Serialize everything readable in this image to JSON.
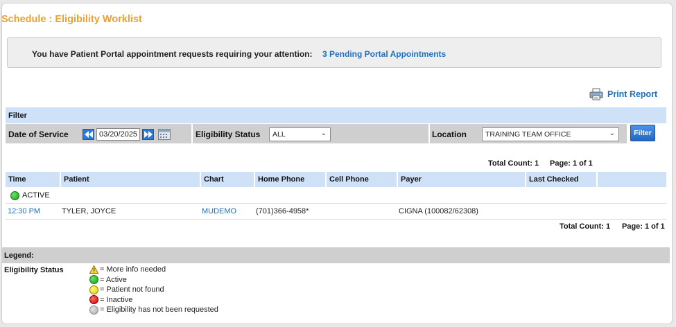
{
  "page": {
    "title": "Schedule : Eligibility Worklist"
  },
  "portal": {
    "message": "You have Patient Portal appointment requests requiring your attention:",
    "link": "3 Pending Portal Appointments"
  },
  "print": {
    "label": "Print Report",
    "icon": "printer-icon"
  },
  "filter": {
    "header": "Filter",
    "date_label": "Date of Service",
    "date_value": "03/20/2025",
    "status_label": "Eligibility Status",
    "status_value": "ALL",
    "location_label": "Location",
    "location_value": "TRAINING TEAM OFFICE",
    "button": "Filter"
  },
  "totals_top": {
    "count": "Total Count: 1",
    "page": "Page: 1 of 1"
  },
  "table": {
    "columns": [
      "Time",
      "Patient",
      "Chart",
      "Home Phone",
      "Cell Phone",
      "Payer",
      "Last Checked",
      ""
    ],
    "group": {
      "label": "ACTIVE",
      "color": "#11a311"
    },
    "rows": [
      {
        "time": "12:30 PM",
        "patient": "TYLER, JOYCE",
        "chart": "MUDEMO",
        "home_phone": "(701)366-4958*",
        "cell_phone": "",
        "payer": "CIGNA (100082/62308)",
        "last_checked": ""
      }
    ]
  },
  "totals_bottom": {
    "count": "Total Count: 1",
    "page": "Page: 1 of 1"
  },
  "legend": {
    "header": "Legend:",
    "title": "Eligibility Status",
    "items": [
      {
        "icon": "warning-icon",
        "text": "= More info needed"
      },
      {
        "icon": "green-dot-icon",
        "text": "= Active"
      },
      {
        "icon": "yellow-dot-icon",
        "text": "= Patient not found"
      },
      {
        "icon": "red-dot-icon",
        "text": "= Inactive"
      },
      {
        "icon": "gray-dot-icon",
        "text": "= Eligibility has not been requested"
      }
    ]
  },
  "colors": {
    "title": "#f0a028",
    "link": "#1f6fc0",
    "header_bg": "#cfe1f7"
  }
}
